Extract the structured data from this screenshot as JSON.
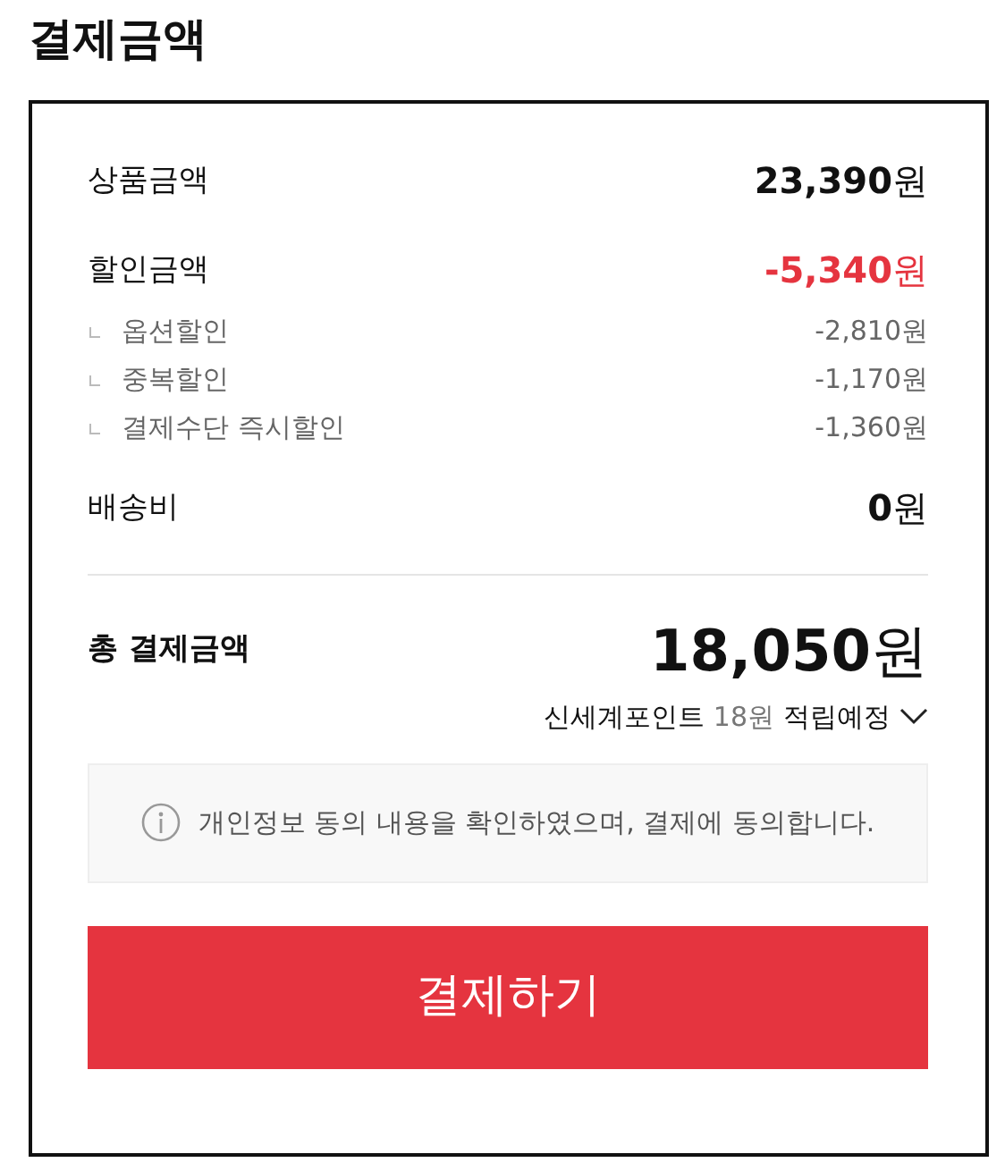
{
  "title": "결제금액",
  "rows": [
    {
      "kind": "main",
      "label": "상품금액",
      "amount": "**23,390**원"
    },
    {
      "kind": "discount",
      "label": "할인금액",
      "amount": "**-5,340**원"
    },
    {
      "kind": "sub",
      "label": "옵션할인",
      "amount": "-2,810원"
    },
    {
      "kind": "sub",
      "label": "중복할인",
      "amount": "-1,170원"
    },
    {
      "kind": "sub",
      "label": "결제수단 즉시할인",
      "amount": "-1,360원"
    },
    {
      "kind": "main",
      "label": "배송비",
      "amount": "**0**원"
    }
  ],
  "total": {
    "label": "총 결제금액",
    "amount": "**18,050**원"
  },
  "points": {
    "prefix": "신세계포인트",
    "value": "18원",
    "suffix": "적립예정",
    "expanded": false
  },
  "notice": "개인정보 동의 내용을 확인하였으며, 결제에 동의합니다.",
  "pay_button": "결제하기"
}
